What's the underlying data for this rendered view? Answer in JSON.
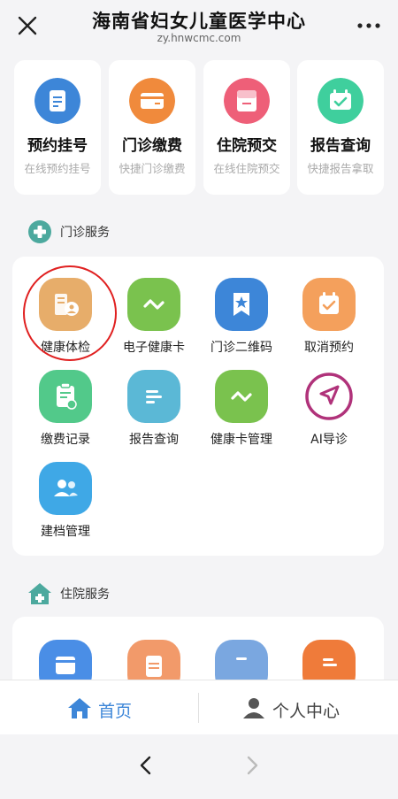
{
  "header": {
    "title": "海南省妇女儿童医学中心",
    "subtitle": "zy.hnwcmc.com"
  },
  "quick_actions": [
    {
      "title": "预约挂号",
      "subtitle": "在线预约挂号",
      "icon": "appointment-icon",
      "color": "#3d86d8"
    },
    {
      "title": "门诊缴费",
      "subtitle": "快捷门诊缴费",
      "icon": "card-payment-icon",
      "color": "#f08a3c"
    },
    {
      "title": "住院预交",
      "subtitle": "在线住院预交",
      "icon": "inpatient-deposit-icon",
      "color": "#ee5f78"
    },
    {
      "title": "报告查询",
      "subtitle": "快捷报告拿取",
      "icon": "report-icon",
      "color": "#3fcf9d"
    }
  ],
  "outpatient": {
    "section_title": "门诊服务",
    "items": [
      {
        "label": "健康体检",
        "icon": "health-checkup-icon",
        "color": "#e7ad6a"
      },
      {
        "label": "电子健康卡",
        "icon": "e-health-card-icon",
        "color": "#7ac24e"
      },
      {
        "label": "门诊二维码",
        "icon": "qr-code-icon",
        "color": "#3d86d8"
      },
      {
        "label": "取消预约",
        "icon": "cancel-appointment-icon",
        "color": "#f4a05c"
      },
      {
        "label": "缴费记录",
        "icon": "payment-record-icon",
        "color": "#52c98a"
      },
      {
        "label": "报告查询",
        "icon": "report-list-icon",
        "color": "#5bb8d6"
      },
      {
        "label": "健康卡管理",
        "icon": "health-card-manage-icon",
        "color": "#7ac24e"
      },
      {
        "label": "AI导诊",
        "icon": "ai-guide-icon",
        "color": "#b0327a"
      },
      {
        "label": "建档管理",
        "icon": "profile-manage-icon",
        "color": "#3fa8e6"
      }
    ]
  },
  "inpatient": {
    "section_title": "住院服务",
    "items": [
      {
        "icon": "inpatient-payment-icon",
        "color": "#4a8ee6"
      },
      {
        "icon": "inpatient-bill-icon",
        "color": "#f29a6a"
      },
      {
        "icon": "inpatient-chat-icon",
        "color": "#7aa7e0"
      },
      {
        "icon": "inpatient-list-icon",
        "color": "#ef7b3a"
      }
    ]
  },
  "tabbar": {
    "home_label": "首页",
    "profile_label": "个人中心",
    "active_color": "#3d86d8"
  }
}
